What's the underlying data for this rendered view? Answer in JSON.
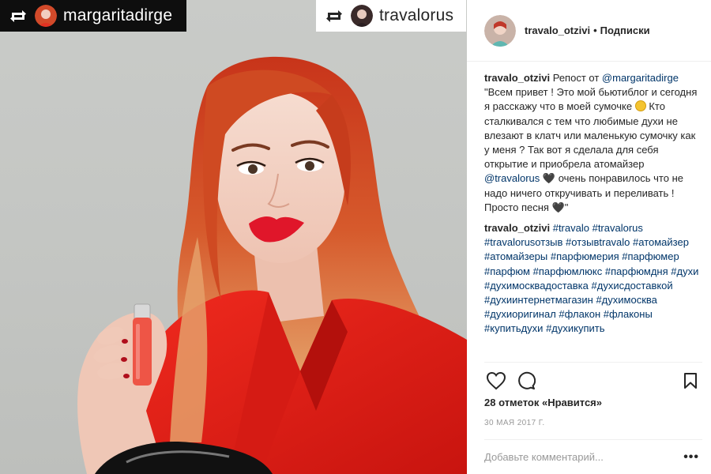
{
  "photo": {
    "repost_tags": [
      {
        "username": "margaritadirge",
        "icon": "repost-icon"
      },
      {
        "username": "travalorus",
        "icon": "repost-icon"
      }
    ]
  },
  "post": {
    "author": "travalo_otzivi",
    "separator": "•",
    "follow_label": "Подписки",
    "caption": {
      "username": "travalo_otzivi",
      "intro": "Репост от",
      "mention_source": "@margaritadirge",
      "text_1": "\"Всем привет ! Это мой бьютиблог и сегодня я расскажу что в моей сумочке",
      "emoji_1": "grinning-face-emoji",
      "text_2": "Кто сталкивался с тем что любимые духи не влезают в клатч или маленькую сумочку как у меня ? Так вот я сделала для себя открытие и приобрела атомайзер",
      "mention_brand": "@travalorus",
      "heart_1": "🖤",
      "text_3": "очень понравилось что не надо ничего откручивать и переливать ! Просто песня",
      "heart_2": "🖤",
      "quote_end": "\""
    },
    "comment": {
      "username": "travalo_otzivi",
      "hashtags": [
        "#travalo",
        "#travalorus",
        "#travalorusотзыв",
        "#отзывtravalo",
        "#атомайзер",
        "#атомайзеры",
        "#парфюмерия",
        "#парфюмер",
        "#парфюм",
        "#парфюмлюкс",
        "#парфюмдня",
        "#духи",
        "#духимосквадоставка",
        "#духисдоставкой",
        "#духиинтернетмагазин",
        "#духимосква",
        "#духиоригинал",
        "#флакон",
        "#флаконы",
        "#купитьдухи",
        "#духикупить"
      ]
    },
    "actions": {
      "like_icon": "heart-outline-icon",
      "comment_icon": "speech-bubble-icon",
      "save_icon": "bookmark-icon"
    },
    "likes_text": "28 отметок «Нравится»",
    "date": "30 мая 2017 г.",
    "comment_placeholder": "Добавьте комментарий...",
    "more_label": "•••"
  },
  "colors": {
    "link": "#003569",
    "text": "#262626",
    "muted": "#999999",
    "divider": "#efefef",
    "shirt_red": "#e8231c"
  }
}
